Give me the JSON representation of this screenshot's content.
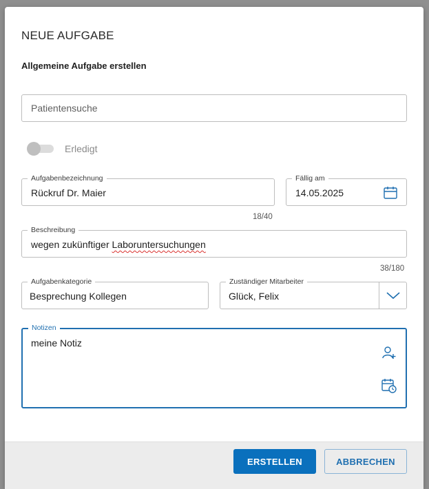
{
  "dialog": {
    "title": "NEUE AUFGABE",
    "subtitle": "Allgemeine Aufgabe erstellen"
  },
  "patient_search": {
    "placeholder": "Patientensuche"
  },
  "done_toggle": {
    "label": "Erledigt",
    "on": false
  },
  "task_name": {
    "label": "Aufgabenbezeichnung",
    "value": "Rückruf Dr. Maier",
    "counter": "18/40"
  },
  "due_date": {
    "label": "Fällig am",
    "value": "14.05.2025"
  },
  "description": {
    "label": "Beschreibung",
    "value_plain": "wegen  zukünftiger ",
    "value_marked": "Laboruntersuchungen",
    "counter": "38/180"
  },
  "category": {
    "label": "Aufgabenkategorie",
    "value": "Besprechung Kollegen"
  },
  "assignee": {
    "label": "Zuständiger Mitarbeiter",
    "value": "Glück, Felix"
  },
  "notes": {
    "label": "Notizen",
    "value": "meine Notiz"
  },
  "footer": {
    "create_label": "ERSTELLEN",
    "cancel_label": "ABBRECHEN"
  },
  "colors": {
    "accent": "#0a70bd",
    "focus_border": "#1f6fb0",
    "overlay": "#8f8f8f"
  },
  "icons": [
    "calendar-icon",
    "chevron-down-icon",
    "add-user-icon",
    "calendar-clock-icon"
  ]
}
